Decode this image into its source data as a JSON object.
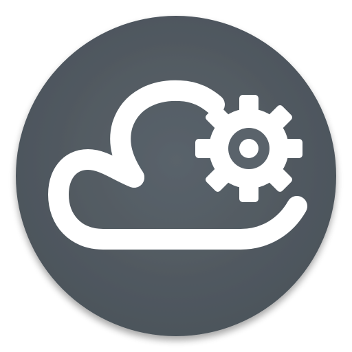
{
  "app_icon": {
    "semantic": "cloud-settings-app-icon",
    "colors": {
      "background_circle": "#5a636b",
      "background_circle_edge": "#4b535a",
      "glyph": "#ffffff",
      "page_background": "#ffffff"
    },
    "icons": [
      "cloud-icon",
      "gear-icon"
    ]
  }
}
